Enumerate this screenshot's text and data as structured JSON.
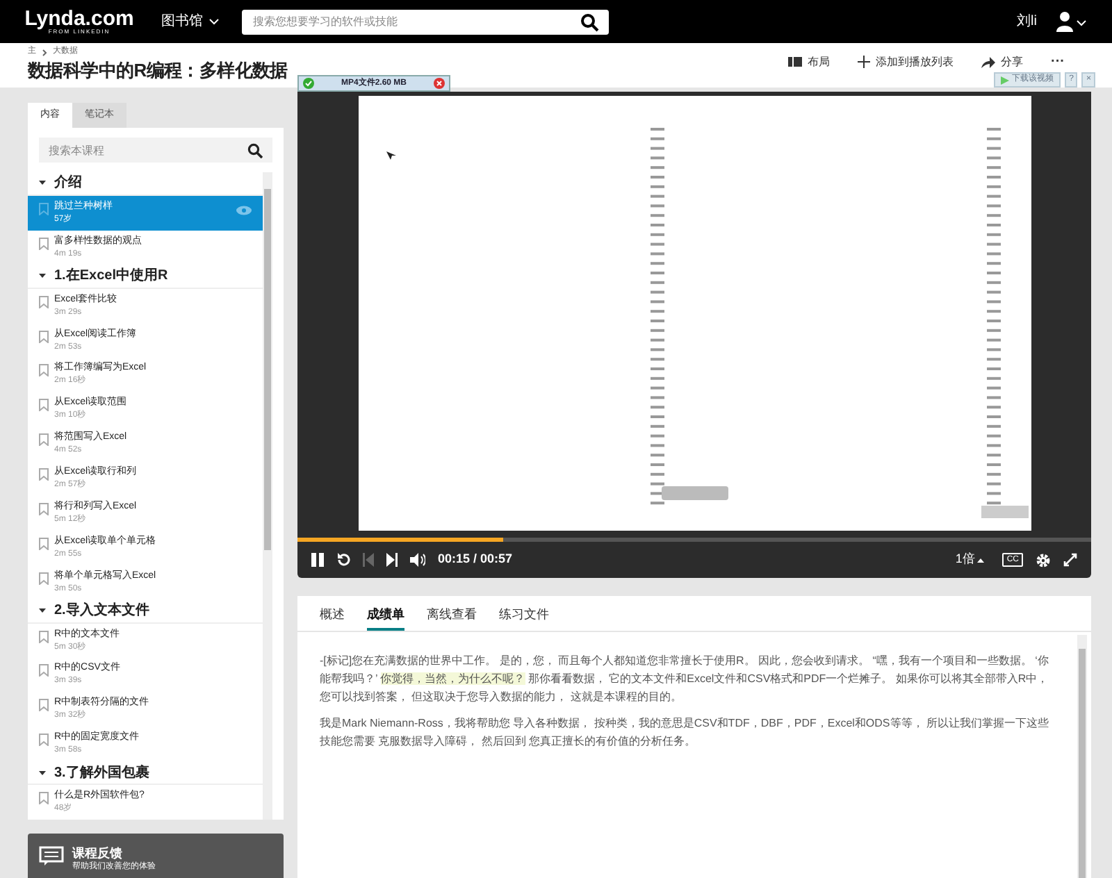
{
  "header": {
    "logo": "Lynda.com",
    "logo_sub": "FROM LINKEDIN",
    "library": "图书馆",
    "search": {
      "placeholder": "搜索您想要学习的软件或技能"
    },
    "user": "刘li"
  },
  "breadcrumb": [
    "主",
    "大数据"
  ],
  "course_title": "数据科学中的R编程：多样化数据",
  "actions": [
    {
      "kind": "layout",
      "label": "布局"
    },
    {
      "kind": "add",
      "label": "添加到播放列表"
    },
    {
      "kind": "share",
      "label": "分享"
    },
    {
      "kind": "more",
      "label": "···"
    }
  ],
  "download_bar": {
    "label": "MP4文件2.60 MB"
  },
  "download_hint": {
    "label": "下载该视频",
    "help": "?",
    "close": "×"
  },
  "sidebar": {
    "tabs": [
      {
        "label": "内容",
        "selected": true
      },
      {
        "label": "笔记本",
        "selected": false
      }
    ],
    "search": {
      "placeholder": "搜索本课程"
    },
    "sections": [
      {
        "title": "介绍",
        "expanded": true,
        "lessons": [
          {
            "title": "跳过兰种树样",
            "duration": "57岁",
            "selected": true
          },
          {
            "title": "富多样性数据的观点",
            "duration": "4m 19s",
            "selected": false
          }
        ]
      },
      {
        "title": "1.在Excel中使用R",
        "expanded": true,
        "lessons": [
          {
            "title": "Excel套件比较",
            "duration": "3m 29s",
            "selected": false
          },
          {
            "title": "从Excel阅读工作簿",
            "duration": "2m 53s",
            "selected": false
          },
          {
            "title": "将工作簿编写为Excel",
            "duration": "2m 16秒",
            "selected": false
          },
          {
            "title": "从Excel读取范围",
            "duration": "3m 10秒",
            "selected": false
          },
          {
            "title": "将范围写入Excel",
            "duration": "4m 52s",
            "selected": false
          },
          {
            "title": "从Excel读取行和列",
            "duration": "2m 57秒",
            "selected": false
          },
          {
            "title": "将行和列写入Excel",
            "duration": "5m 12秒",
            "selected": false
          },
          {
            "title": "从Excel读取单个单元格",
            "duration": "2m 55s",
            "selected": false
          },
          {
            "title": "将单个单元格写入Excel",
            "duration": "3m 50s",
            "selected": false
          }
        ]
      },
      {
        "title": "2.导入文本文件",
        "expanded": true,
        "lessons": [
          {
            "title": "R中的文本文件",
            "duration": "5m 30秒",
            "selected": false
          },
          {
            "title": "R中的CSV文件",
            "duration": "3m 39s",
            "selected": false
          },
          {
            "title": "R中制表符分隔的文件",
            "duration": "3m 32秒",
            "selected": false
          },
          {
            "title": "R中的固定宽度文件",
            "duration": "3m 58s",
            "selected": false
          }
        ]
      },
      {
        "title": "3.了解外国包裹",
        "expanded": true,
        "lessons": [
          {
            "title": "什么是R外国软件包?",
            "duration": "48岁",
            "selected": false
          }
        ]
      }
    ]
  },
  "feedback": {
    "title": "课程反馈",
    "subtitle": "帮助我们改善您的体验"
  },
  "player": {
    "playing": true,
    "level": 0.26,
    "time": "00:15 / 00:57",
    "speed": "1倍",
    "cc": "CC"
  },
  "content_tabs": [
    {
      "label": "概述",
      "selected": false
    },
    {
      "label": "成绩单",
      "selected": true
    },
    {
      "label": "离线查看",
      "selected": false
    },
    {
      "label": "练习文件",
      "selected": false
    }
  ],
  "transcript": [
    [
      {
        "text": "-[标记]您在充满数据的世界中工作。 是的，您， 而且每个人都知道您非常擅长于使用R。 因此，您会收到请求。 “嘿，我有一个项目和一些数据。 ‘你能帮我吗？’ ",
        "current": false
      },
      {
        "text": "你觉得，当然，为什么不呢？",
        "current": true
      },
      {
        "text": " 那你看看数据， 它的文本文件和Excel文件和CSV格式和PDF一个烂摊子。 如果你可以将其全部带入R中，您可以找到答案， 但这取决于您导入数据的能力， 这就是本课程的目的。",
        "current": false
      }
    ],
    [
      {
        "text": "我是Mark Niemann-Ross，我将帮助您 导入各种数据， 按种类，我的意思是CSV和TDF，DBF，PDF，Excel和ODS等等， 所以让我们掌握一下这些技能您需要 克服数据导入障碍， 然后回到 您真正擅长的有价值的分析任务。",
        "current": false
      }
    ]
  ]
}
